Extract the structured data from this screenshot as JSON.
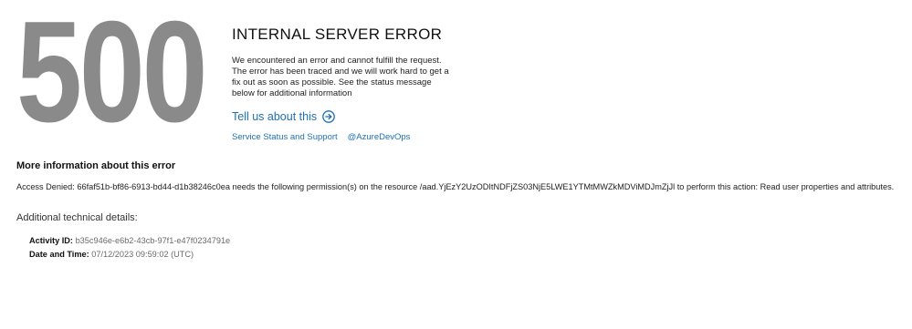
{
  "error_code": "500",
  "title": "INTERNAL SERVER ERROR",
  "description": "We encountered an error and cannot fulfill the request. The error has been traced and we will work hard to get a fix out as soon as possible. See the status message below for additional information",
  "tell_us": {
    "label": "Tell us about this",
    "icon": "arrow-right-circle-icon"
  },
  "links": {
    "service_status": "Service Status and Support",
    "azure_devops": "@AzureDevOps"
  },
  "more_info": {
    "title": "More information about this error",
    "message": "Access Denied: 66faf51b-bf86-6913-bd44-d1b38246c0ea needs the following permission(s) on the resource /aad.YjEzY2UzODItNDFjZS03NjE5LWE1YTMtMWZkMDViMDJmZjJl to perform this action: Read user properties and attributes."
  },
  "technical": {
    "title": "Additional technical details:",
    "activity_id_label": "Activity ID:",
    "activity_id_value": "b35c946e-e6b2-43cb-97f1-e47f0234791e",
    "date_time_label": "Date and Time:",
    "date_time_value": "07/12/2023 09:59:02 (UTC)"
  },
  "colors": {
    "error_code": "#8a8a8a",
    "link": "#1f6fb5"
  }
}
